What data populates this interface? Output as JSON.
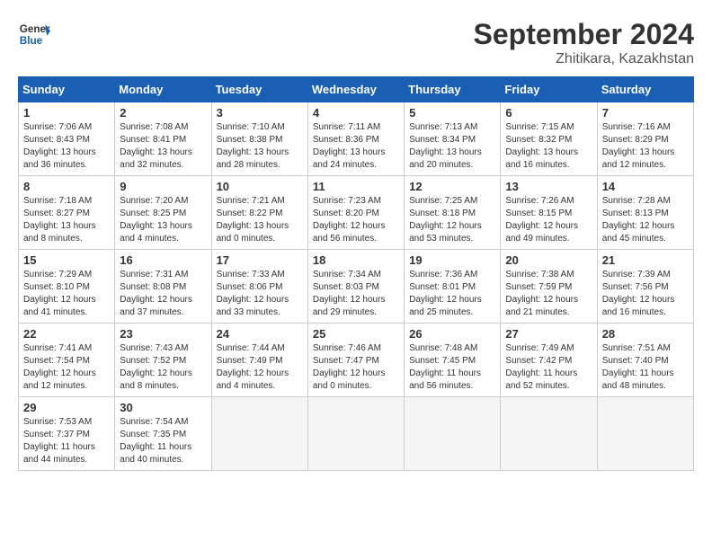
{
  "header": {
    "logo_line1": "General",
    "logo_line2": "Blue",
    "month": "September 2024",
    "location": "Zhitikara, Kazakhstan"
  },
  "days_of_week": [
    "Sunday",
    "Monday",
    "Tuesday",
    "Wednesday",
    "Thursday",
    "Friday",
    "Saturday"
  ],
  "weeks": [
    [
      {
        "day": "1",
        "text": "Sunrise: 7:06 AM\nSunset: 8:43 PM\nDaylight: 13 hours\nand 36 minutes."
      },
      {
        "day": "2",
        "text": "Sunrise: 7:08 AM\nSunset: 8:41 PM\nDaylight: 13 hours\nand 32 minutes."
      },
      {
        "day": "3",
        "text": "Sunrise: 7:10 AM\nSunset: 8:38 PM\nDaylight: 13 hours\nand 28 minutes."
      },
      {
        "day": "4",
        "text": "Sunrise: 7:11 AM\nSunset: 8:36 PM\nDaylight: 13 hours\nand 24 minutes."
      },
      {
        "day": "5",
        "text": "Sunrise: 7:13 AM\nSunset: 8:34 PM\nDaylight: 13 hours\nand 20 minutes."
      },
      {
        "day": "6",
        "text": "Sunrise: 7:15 AM\nSunset: 8:32 PM\nDaylight: 13 hours\nand 16 minutes."
      },
      {
        "day": "7",
        "text": "Sunrise: 7:16 AM\nSunset: 8:29 PM\nDaylight: 13 hours\nand 12 minutes."
      }
    ],
    [
      {
        "day": "8",
        "text": "Sunrise: 7:18 AM\nSunset: 8:27 PM\nDaylight: 13 hours\nand 8 minutes."
      },
      {
        "day": "9",
        "text": "Sunrise: 7:20 AM\nSunset: 8:25 PM\nDaylight: 13 hours\nand 4 minutes."
      },
      {
        "day": "10",
        "text": "Sunrise: 7:21 AM\nSunset: 8:22 PM\nDaylight: 13 hours\nand 0 minutes."
      },
      {
        "day": "11",
        "text": "Sunrise: 7:23 AM\nSunset: 8:20 PM\nDaylight: 12 hours\nand 56 minutes."
      },
      {
        "day": "12",
        "text": "Sunrise: 7:25 AM\nSunset: 8:18 PM\nDaylight: 12 hours\nand 53 minutes."
      },
      {
        "day": "13",
        "text": "Sunrise: 7:26 AM\nSunset: 8:15 PM\nDaylight: 12 hours\nand 49 minutes."
      },
      {
        "day": "14",
        "text": "Sunrise: 7:28 AM\nSunset: 8:13 PM\nDaylight: 12 hours\nand 45 minutes."
      }
    ],
    [
      {
        "day": "15",
        "text": "Sunrise: 7:29 AM\nSunset: 8:10 PM\nDaylight: 12 hours\nand 41 minutes."
      },
      {
        "day": "16",
        "text": "Sunrise: 7:31 AM\nSunset: 8:08 PM\nDaylight: 12 hours\nand 37 minutes."
      },
      {
        "day": "17",
        "text": "Sunrise: 7:33 AM\nSunset: 8:06 PM\nDaylight: 12 hours\nand 33 minutes."
      },
      {
        "day": "18",
        "text": "Sunrise: 7:34 AM\nSunset: 8:03 PM\nDaylight: 12 hours\nand 29 minutes."
      },
      {
        "day": "19",
        "text": "Sunrise: 7:36 AM\nSunset: 8:01 PM\nDaylight: 12 hours\nand 25 minutes."
      },
      {
        "day": "20",
        "text": "Sunrise: 7:38 AM\nSunset: 7:59 PM\nDaylight: 12 hours\nand 21 minutes."
      },
      {
        "day": "21",
        "text": "Sunrise: 7:39 AM\nSunset: 7:56 PM\nDaylight: 12 hours\nand 16 minutes."
      }
    ],
    [
      {
        "day": "22",
        "text": "Sunrise: 7:41 AM\nSunset: 7:54 PM\nDaylight: 12 hours\nand 12 minutes."
      },
      {
        "day": "23",
        "text": "Sunrise: 7:43 AM\nSunset: 7:52 PM\nDaylight: 12 hours\nand 8 minutes."
      },
      {
        "day": "24",
        "text": "Sunrise: 7:44 AM\nSunset: 7:49 PM\nDaylight: 12 hours\nand 4 minutes."
      },
      {
        "day": "25",
        "text": "Sunrise: 7:46 AM\nSunset: 7:47 PM\nDaylight: 12 hours\nand 0 minutes."
      },
      {
        "day": "26",
        "text": "Sunrise: 7:48 AM\nSunset: 7:45 PM\nDaylight: 11 hours\nand 56 minutes."
      },
      {
        "day": "27",
        "text": "Sunrise: 7:49 AM\nSunset: 7:42 PM\nDaylight: 11 hours\nand 52 minutes."
      },
      {
        "day": "28",
        "text": "Sunrise: 7:51 AM\nSunset: 7:40 PM\nDaylight: 11 hours\nand 48 minutes."
      }
    ],
    [
      {
        "day": "29",
        "text": "Sunrise: 7:53 AM\nSunset: 7:37 PM\nDaylight: 11 hours\nand 44 minutes."
      },
      {
        "day": "30",
        "text": "Sunrise: 7:54 AM\nSunset: 7:35 PM\nDaylight: 11 hours\nand 40 minutes."
      },
      {
        "day": "",
        "text": ""
      },
      {
        "day": "",
        "text": ""
      },
      {
        "day": "",
        "text": ""
      },
      {
        "day": "",
        "text": ""
      },
      {
        "day": "",
        "text": ""
      }
    ]
  ]
}
